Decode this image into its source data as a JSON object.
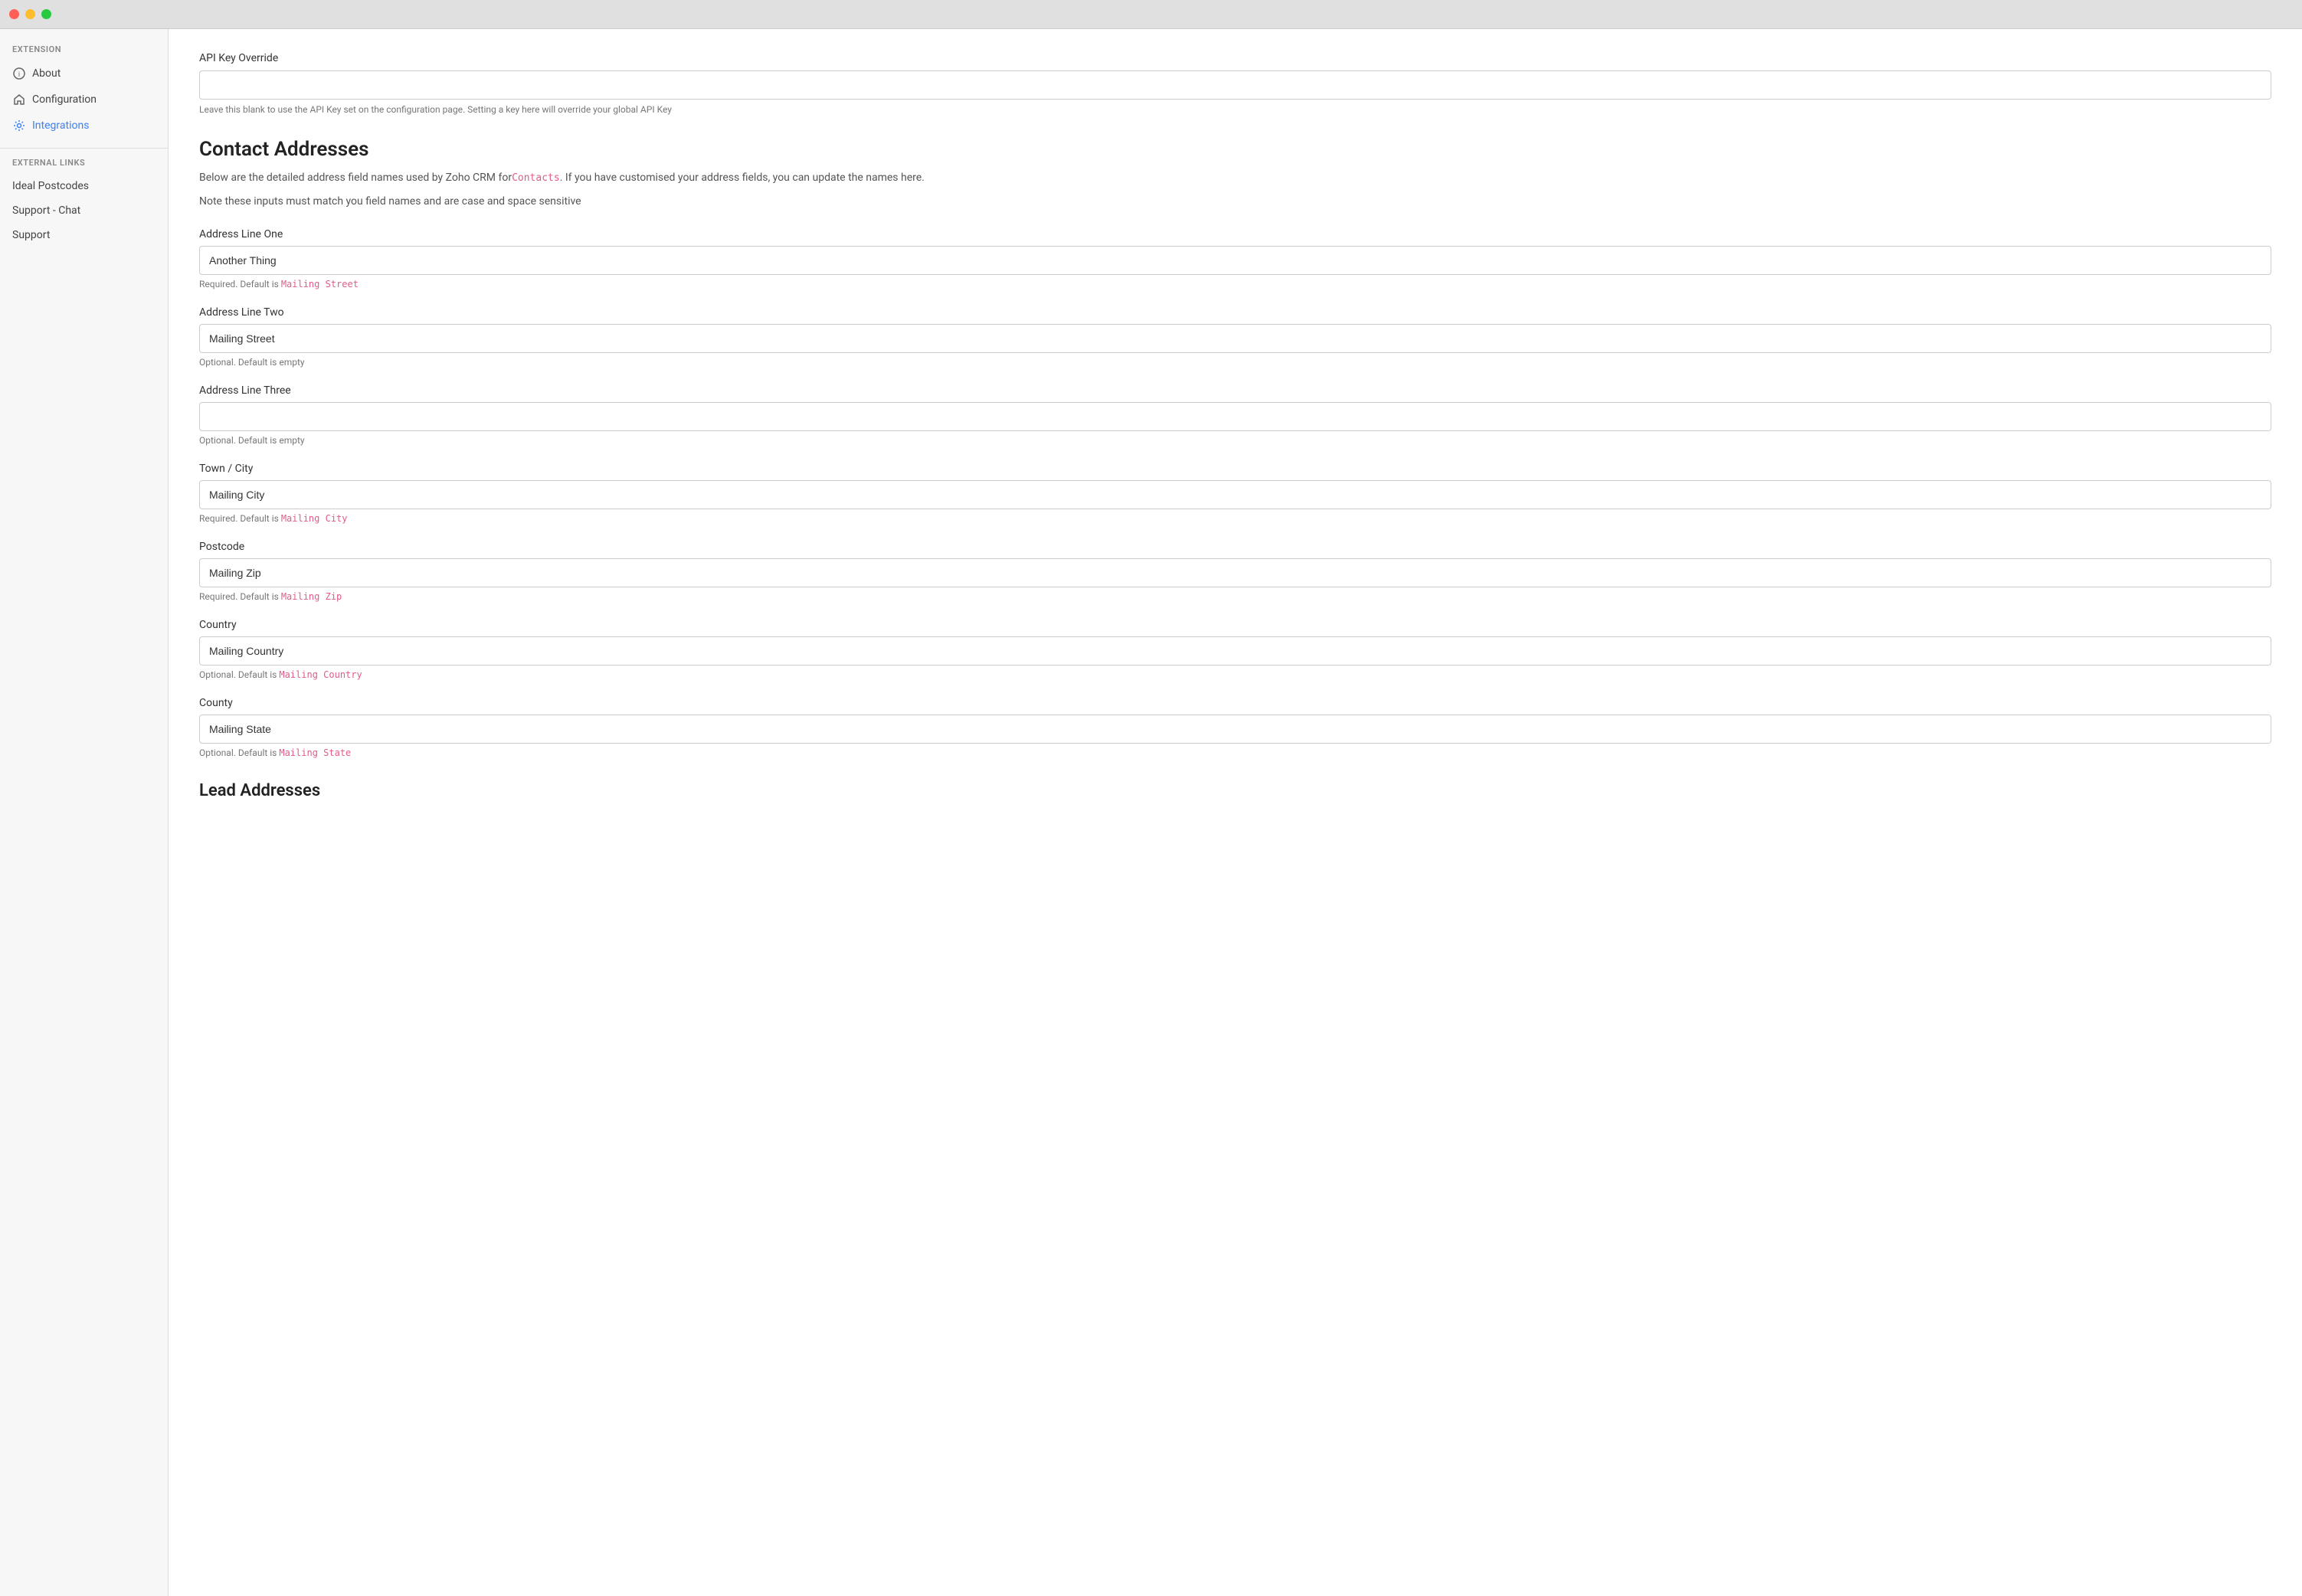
{
  "titlebar": {
    "buttons": [
      "close",
      "minimize",
      "maximize"
    ]
  },
  "sidebar": {
    "extension_label": "EXTENSION",
    "external_links_label": "EXTERNAL LINKS",
    "items": [
      {
        "id": "about",
        "label": "About",
        "icon": "info-icon",
        "active": false
      },
      {
        "id": "configuration",
        "label": "Configuration",
        "icon": "home-icon",
        "active": false
      },
      {
        "id": "integrations",
        "label": "Integrations",
        "icon": "gear-icon",
        "active": true
      }
    ],
    "external_items": [
      {
        "id": "ideal-postcodes",
        "label": "Ideal Postcodes",
        "icon": null
      },
      {
        "id": "support-chat",
        "label": "Support - Chat",
        "icon": null
      },
      {
        "id": "support",
        "label": "Support",
        "icon": null
      }
    ]
  },
  "main": {
    "api_key_section": {
      "label": "API Key Override",
      "value": "",
      "placeholder": "",
      "hint": "Leave this blank to use the API Key set on the configuration page. Setting a key here will override your global API Key"
    },
    "contact_addresses": {
      "heading": "Contact Addresses",
      "desc_prefix": "Below are the detailed address field names used by Zoho CRM for",
      "desc_link": "Contacts",
      "desc_suffix": ". If you have customised your address fields, you can update the names here.",
      "note": "Note these inputs must match you field names and are case and space sensitive",
      "fields": [
        {
          "id": "address-line-one",
          "label": "Address Line One",
          "value": "Another Thing",
          "placeholder": "",
          "hint_prefix": "Required. Default is ",
          "hint_code": "Mailing Street",
          "hint_suffix": ""
        },
        {
          "id": "address-line-two",
          "label": "Address Line Two",
          "value": "Mailing Street",
          "placeholder": "",
          "hint_prefix": "Optional. Default is empty",
          "hint_code": "",
          "hint_suffix": ""
        },
        {
          "id": "address-line-three",
          "label": "Address Line Three",
          "value": "",
          "placeholder": "",
          "hint_prefix": "Optional. Default is empty",
          "hint_code": "",
          "hint_suffix": ""
        },
        {
          "id": "town-city",
          "label": "Town / City",
          "value": "Mailing City",
          "placeholder": "",
          "hint_prefix": "Required. Default is ",
          "hint_code": "Mailing City",
          "hint_suffix": ""
        },
        {
          "id": "postcode",
          "label": "Postcode",
          "value": "Mailing Zip",
          "placeholder": "",
          "hint_prefix": "Required. Default is ",
          "hint_code": "Mailing Zip",
          "hint_suffix": ""
        },
        {
          "id": "country",
          "label": "Country",
          "value": "Mailing Country",
          "placeholder": "",
          "hint_prefix": "Optional. Default is ",
          "hint_code": "Mailing Country",
          "hint_suffix": ""
        },
        {
          "id": "county",
          "label": "County",
          "value": "Mailing State",
          "placeholder": "",
          "hint_prefix": "Optional. Default is ",
          "hint_code": "Mailing State",
          "hint_suffix": ""
        }
      ]
    },
    "lead_addresses": {
      "heading": "Lead Addresses"
    }
  }
}
